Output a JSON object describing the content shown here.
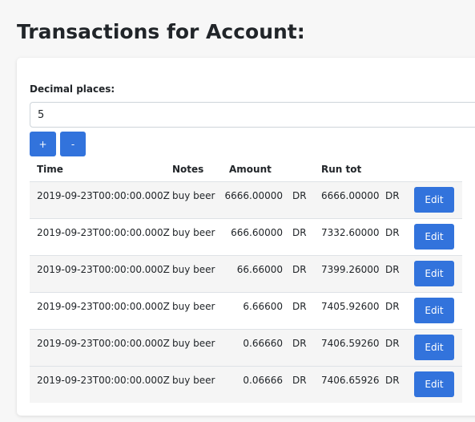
{
  "page": {
    "title": "Transactions for Account:"
  },
  "controls": {
    "decimal_label": "Decimal places:",
    "decimal_value": "5",
    "plus_label": "+",
    "minus_label": "-"
  },
  "table": {
    "headers": {
      "time": "Time",
      "notes": "Notes",
      "amount": "Amount",
      "run_tot": "Run tot"
    },
    "rows": [
      {
        "time": "2019-09-23T00:00:00.000Z",
        "notes": "buy beer",
        "amount": "6666.00000",
        "amount_dr": "DR",
        "run_tot": "6666.00000",
        "run_dr": "DR",
        "edit_label": "Edit"
      },
      {
        "time": "2019-09-23T00:00:00.000Z",
        "notes": "buy beer",
        "amount": "666.60000",
        "amount_dr": "DR",
        "run_tot": "7332.60000",
        "run_dr": "DR",
        "edit_label": "Edit"
      },
      {
        "time": "2019-09-23T00:00:00.000Z",
        "notes": "buy beer",
        "amount": "66.66000",
        "amount_dr": "DR",
        "run_tot": "7399.26000",
        "run_dr": "DR",
        "edit_label": "Edit"
      },
      {
        "time": "2019-09-23T00:00:00.000Z",
        "notes": "buy beer",
        "amount": "6.66600",
        "amount_dr": "DR",
        "run_tot": "7405.92600",
        "run_dr": "DR",
        "edit_label": "Edit"
      },
      {
        "time": "2019-09-23T00:00:00.000Z",
        "notes": "buy beer",
        "amount": "0.66660",
        "amount_dr": "DR",
        "run_tot": "7406.59260",
        "run_dr": "DR",
        "edit_label": "Edit"
      },
      {
        "time": "2019-09-23T00:00:00.000Z",
        "notes": "buy beer",
        "amount": "0.06666",
        "amount_dr": "DR",
        "run_tot": "7406.65926",
        "run_dr": "DR",
        "edit_label": "Edit"
      }
    ]
  },
  "colors": {
    "accent": "#3273dc",
    "stripe": "#f5f5f5"
  }
}
